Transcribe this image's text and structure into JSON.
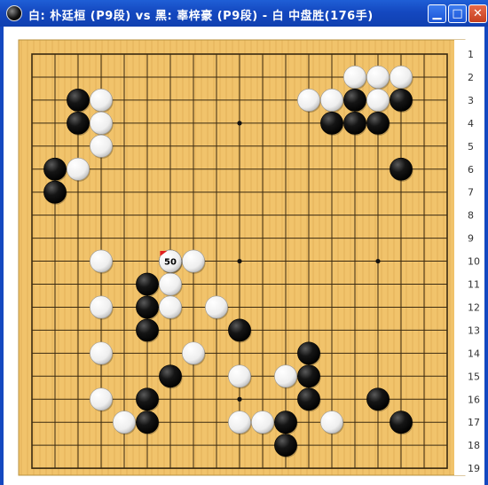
{
  "window": {
    "title": "白: 朴廷桓 (P9段) vs 黑: 辜梓豪 (P9段) - 白 中盘胜(176手)",
    "icon": "go-stone-icon"
  },
  "controls": {
    "minimize_icon": "minimize-icon",
    "maximize_icon": "maximize-icon",
    "close_icon": "close-icon"
  },
  "colors": {
    "board": "#f1c36b",
    "grid": "#3a2a10",
    "title_bar": "#1448c0",
    "last_move_marker": "#e02020"
  },
  "board": {
    "size": 19,
    "row_labels": [
      "1",
      "2",
      "3",
      "4",
      "5",
      "6",
      "7",
      "8",
      "9",
      "10",
      "11",
      "12",
      "13",
      "14",
      "15",
      "16",
      "17",
      "18",
      "19"
    ],
    "star_points": [
      [
        10,
        4
      ],
      [
        10,
        10
      ],
      [
        16,
        10
      ],
      [
        10,
        16
      ]
    ],
    "last_move": {
      "col": 7,
      "row": 10,
      "label": "50"
    },
    "stones": [
      {
        "c": "w",
        "col": 15,
        "row": 2
      },
      {
        "c": "w",
        "col": 16,
        "row": 2
      },
      {
        "c": "w",
        "col": 17,
        "row": 2
      },
      {
        "c": "b",
        "col": 3,
        "row": 3
      },
      {
        "c": "w",
        "col": 4,
        "row": 3
      },
      {
        "c": "w",
        "col": 13,
        "row": 3
      },
      {
        "c": "w",
        "col": 14,
        "row": 3
      },
      {
        "c": "b",
        "col": 15,
        "row": 3
      },
      {
        "c": "w",
        "col": 16,
        "row": 3
      },
      {
        "c": "b",
        "col": 17,
        "row": 3
      },
      {
        "c": "b",
        "col": 3,
        "row": 4
      },
      {
        "c": "w",
        "col": 4,
        "row": 4
      },
      {
        "c": "b",
        "col": 14,
        "row": 4
      },
      {
        "c": "b",
        "col": 15,
        "row": 4
      },
      {
        "c": "b",
        "col": 16,
        "row": 4
      },
      {
        "c": "w",
        "col": 4,
        "row": 5
      },
      {
        "c": "b",
        "col": 2,
        "row": 6
      },
      {
        "c": "w",
        "col": 3,
        "row": 6
      },
      {
        "c": "b",
        "col": 17,
        "row": 6
      },
      {
        "c": "b",
        "col": 2,
        "row": 7
      },
      {
        "c": "w",
        "col": 4,
        "row": 10
      },
      {
        "c": "b",
        "col": 7,
        "row": 10
      },
      {
        "c": "w",
        "col": 8,
        "row": 10
      },
      {
        "c": "b",
        "col": 6,
        "row": 11
      },
      {
        "c": "w",
        "col": 7,
        "row": 11
      },
      {
        "c": "w",
        "col": 4,
        "row": 12
      },
      {
        "c": "b",
        "col": 6,
        "row": 12
      },
      {
        "c": "w",
        "col": 7,
        "row": 12
      },
      {
        "c": "w",
        "col": 9,
        "row": 12
      },
      {
        "c": "b",
        "col": 6,
        "row": 13
      },
      {
        "c": "b",
        "col": 10,
        "row": 13
      },
      {
        "c": "w",
        "col": 4,
        "row": 14
      },
      {
        "c": "w",
        "col": 8,
        "row": 14
      },
      {
        "c": "b",
        "col": 13,
        "row": 14
      },
      {
        "c": "b",
        "col": 7,
        "row": 15
      },
      {
        "c": "w",
        "col": 10,
        "row": 15
      },
      {
        "c": "w",
        "col": 12,
        "row": 15
      },
      {
        "c": "b",
        "col": 13,
        "row": 15
      },
      {
        "c": "w",
        "col": 4,
        "row": 16
      },
      {
        "c": "b",
        "col": 6,
        "row": 16
      },
      {
        "c": "b",
        "col": 13,
        "row": 16
      },
      {
        "c": "b",
        "col": 16,
        "row": 16
      },
      {
        "c": "w",
        "col": 5,
        "row": 17
      },
      {
        "c": "b",
        "col": 6,
        "row": 17
      },
      {
        "c": "w",
        "col": 10,
        "row": 17
      },
      {
        "c": "w",
        "col": 11,
        "row": 17
      },
      {
        "c": "b",
        "col": 12,
        "row": 17
      },
      {
        "c": "w",
        "col": 14,
        "row": 17
      },
      {
        "c": "b",
        "col": 17,
        "row": 17
      },
      {
        "c": "b",
        "col": 12,
        "row": 18
      }
    ]
  }
}
